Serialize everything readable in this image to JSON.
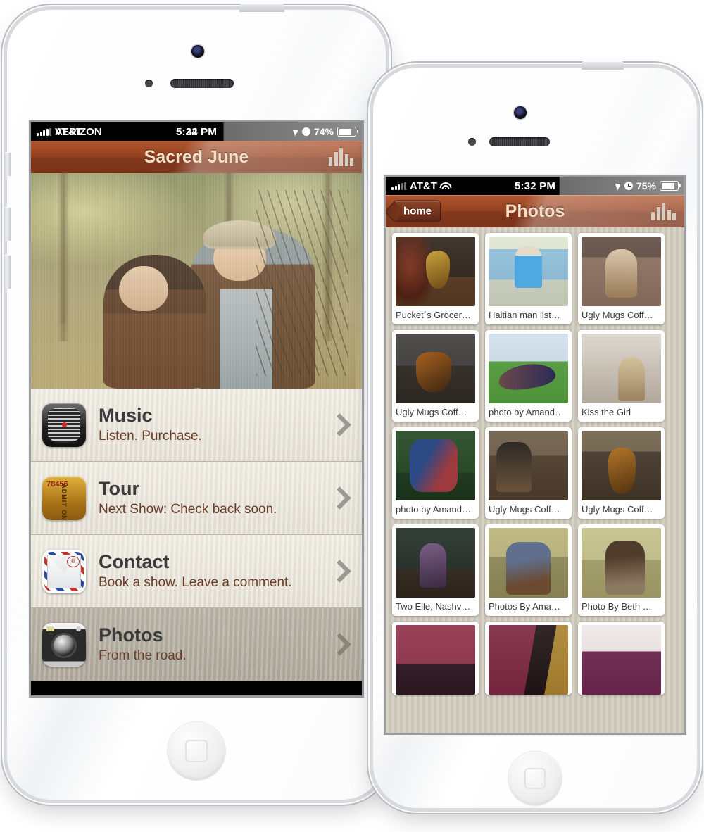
{
  "left_phone": {
    "status_bar": {
      "carrier_primary": "AT&T",
      "carrier_ghost": "VERIZON",
      "signal_icon": "signal-bars-icon",
      "time_primary": "5:32 PM",
      "time_ghost": "5:24 PM",
      "location_icon": "location-arrow-icon",
      "alarm_icon": "clock-icon",
      "battery_percent": "74%",
      "battery_icon": "battery-icon"
    },
    "nav_bar": {
      "title": "Sacred June",
      "right_icon": "equalizer-bars-icon"
    },
    "hero": {
      "alt": "band-photo-duo-with-upright-bass"
    },
    "menu": [
      {
        "icon": "microphone-icon",
        "title": "Music",
        "subtitle": "Listen. Purchase.",
        "chevron": "chevron-right-icon",
        "selected": false
      },
      {
        "icon": "ticket-icon",
        "title": "Tour",
        "subtitle": "Next Show: Check back soon.",
        "chevron": "chevron-right-icon",
        "selected": false
      },
      {
        "icon": "envelope-icon",
        "title": "Contact",
        "subtitle": "Book a show. Leave a comment.",
        "chevron": "chevron-right-icon",
        "selected": false
      },
      {
        "icon": "camera-icon",
        "title": "Photos",
        "subtitle": "From the road.",
        "chevron": "chevron-right-icon",
        "selected": true
      }
    ]
  },
  "right_phone": {
    "status_bar": {
      "carrier": "AT&T",
      "signal_icon": "signal-bars-icon",
      "wifi_icon": "wifi-icon",
      "time": "5:32 PM",
      "location_icon": "location-arrow-icon",
      "alarm_icon": "clock-icon",
      "battery_percent": "75%",
      "battery_icon": "battery-icon"
    },
    "nav_bar": {
      "back_label": "home",
      "title": "Photos",
      "right_icon": "equalizer-bars-icon"
    },
    "photos": [
      {
        "caption": "Pucket´s Grocer…",
        "art": "t-stage"
      },
      {
        "caption": "Haitian man list…",
        "art": "t-haiti"
      },
      {
        "caption": "Ugly Mugs Coff…",
        "art": "t-mug1"
      },
      {
        "caption": "Ugly Mugs Coff…",
        "art": "t-guitar"
      },
      {
        "caption": "photo by Amand…",
        "art": "t-field"
      },
      {
        "caption": "Kiss the Girl",
        "art": "t-kiss"
      },
      {
        "caption": "photo by Amand…",
        "art": "t-dance"
      },
      {
        "caption": "Ugly Mugs Coff…",
        "art": "t-mug2"
      },
      {
        "caption": "Ugly Mugs Coff…",
        "art": "t-mug3"
      },
      {
        "caption": "Two Elle, Nashv…",
        "art": "t-twoelle"
      },
      {
        "caption": "Photos By Ama…",
        "art": "t-amanda"
      },
      {
        "caption": "Photo By Beth …",
        "art": "t-beth"
      }
    ],
    "photos_partial_row": [
      {
        "art": "t-red1"
      },
      {
        "art": "t-red2"
      },
      {
        "art": "t-purple"
      }
    ]
  },
  "colors": {
    "nav_brown": "#93401f",
    "nav_title": "#f4dfc8",
    "menu_row": "#eae5da",
    "menu_row_selected": "#b3ada0",
    "subtitle_brown": "#6a3c2a",
    "grid_bg": "#d2ccc0"
  }
}
